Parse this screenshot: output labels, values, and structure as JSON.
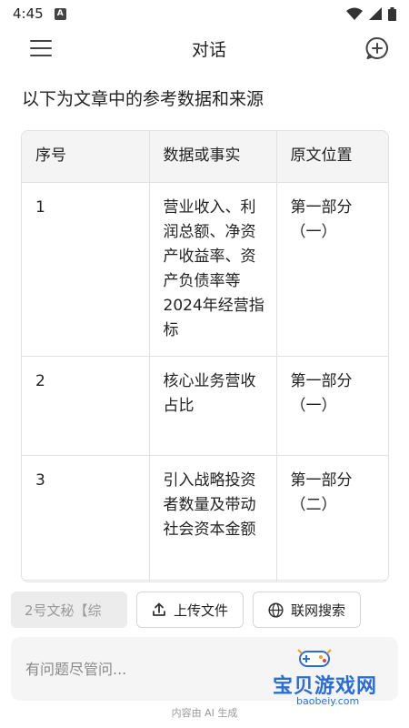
{
  "status": {
    "time": "4:45",
    "notif_letter": "A"
  },
  "header": {
    "title": "对话"
  },
  "intro": "以下为文章中的参考数据和来源",
  "table": {
    "headers": [
      "序号",
      "数据或事实",
      "原文位置"
    ],
    "rows": [
      [
        "1",
        "营业收入、利润总额、净资产收益率、资产负债率等2024年经营指标",
        "第一部分（一）"
      ],
      [
        "2",
        "核心业务营收占比",
        "第一部分（一）"
      ],
      [
        "3",
        "引入战略投资者数量及带动社会资本金额",
        "第一部分（二）"
      ]
    ]
  },
  "actions": {
    "assistant_label": "2号文秘【综",
    "upload_label": "上传文件",
    "search_label": "联网搜索"
  },
  "input": {
    "placeholder": "有问题尽管问..."
  },
  "footer": "内容由 AI 生成",
  "watermark": {
    "text": "宝贝游戏网",
    "url": "baobeiy.com"
  },
  "icons": {
    "menu": "menu-icon",
    "new_chat": "new-chat-icon",
    "upload": "upload-icon",
    "globe": "globe-icon",
    "wifi": "wifi-icon",
    "battery": "battery-icon"
  },
  "colors": {
    "accent": "#2a6dd8",
    "chip_grey": "#ececec"
  }
}
